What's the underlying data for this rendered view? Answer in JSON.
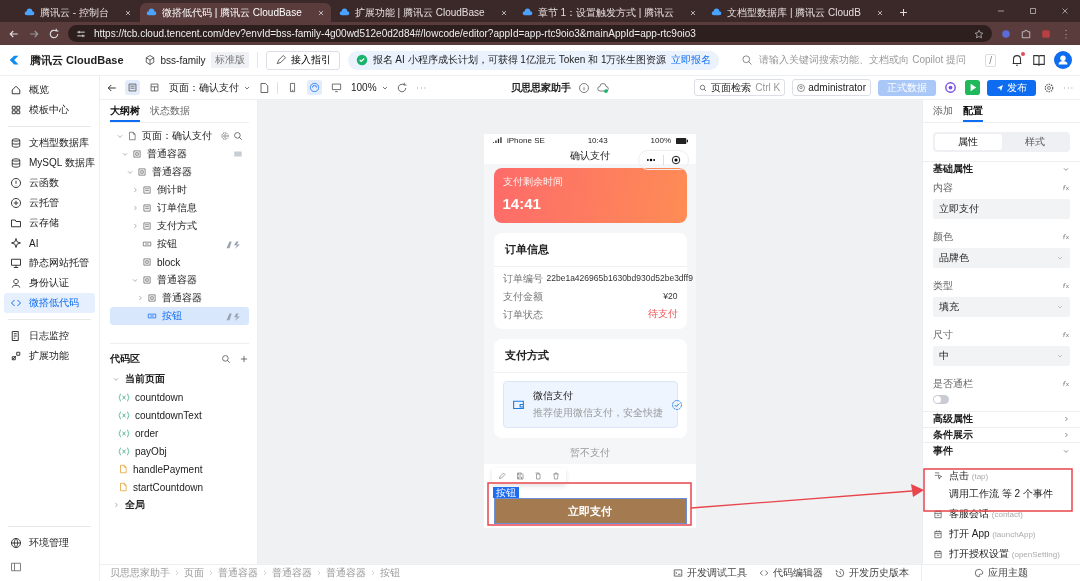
{
  "browser": {
    "tabs": [
      {
        "title": "腾讯云 - 控制台",
        "selected": false
      },
      {
        "title": "微搭低代码 | 腾讯云 CloudBase",
        "selected": true
      },
      {
        "title": "扩展功能 | 腾讯云 CloudBase",
        "selected": false
      },
      {
        "title": "章节 1：设置触发方式 | 腾讯云",
        "selected": false
      },
      {
        "title": "文档型数据库 | 腾讯云 CloudB",
        "selected": false
      }
    ],
    "url": "https://tcb.cloud.tencent.com/dev?envId=bss-family-4g00wd512e0d2d84#/lowcode/editor?appId=app-rtc9oio3&mainAppId=app-rtc9oio3"
  },
  "header": {
    "brand": "腾讯云 CloudBase",
    "env": "bss-family",
    "edition": "标准版",
    "guide": "接入指引",
    "banner": {
      "text": "报名 AI 小程序成长计划，可获得 1亿混元 Token 和 1万张生图资源",
      "link": "立即报名"
    },
    "search": {
      "placeholder": "请输入关键词搜索功能、文档或向 Copilot 提问",
      "shortcut": "/"
    },
    "unread": true
  },
  "nav": {
    "groups": [
      [
        {
          "label": "概览",
          "kind": "home",
          "selected": false
        },
        {
          "label": "模板中心",
          "kind": "grid",
          "selected": false
        }
      ],
      [
        {
          "label": "文档型数据库",
          "kind": "database",
          "selected": false
        },
        {
          "label": "MySQL 数据库",
          "kind": "database",
          "selected": false
        },
        {
          "label": "云函数",
          "kind": "function",
          "selected": false
        },
        {
          "label": "云托管",
          "kind": "container",
          "selected": false
        },
        {
          "label": "云存储",
          "kind": "storage",
          "selected": false
        },
        {
          "label": "AI",
          "kind": "ai",
          "selected": false
        },
        {
          "label": "静态网站托管",
          "kind": "web",
          "selected": false
        },
        {
          "label": "身份认证",
          "kind": "user",
          "selected": false
        },
        {
          "label": "微搭低代码",
          "kind": "lowcode",
          "selected": true
        }
      ],
      [
        {
          "label": "日志监控",
          "kind": "log",
          "selected": false
        },
        {
          "label": "扩展功能",
          "kind": "extension",
          "selected": false
        }
      ]
    ],
    "footer": [
      {
        "label": "环境管理",
        "kind": "globe",
        "selected": false
      }
    ]
  },
  "toolbar": {
    "views": [
      {
        "kind": "outline",
        "selected": true
      },
      {
        "kind": "layout",
        "selected": false
      }
    ],
    "page": "页面：确认支付",
    "devices": [
      {
        "kind": "mobile",
        "selected": false
      },
      {
        "kind": "responsive",
        "selected": true
      },
      {
        "kind": "desktop",
        "selected": false
      }
    ],
    "zoom": "100%",
    "app_name": "贝思思家助手",
    "search": {
      "placeholder": "页面检索",
      "shortcut": "Ctrl K"
    },
    "user": "administrator",
    "data_mode": "正式数据",
    "publish": "发布"
  },
  "outline": {
    "tabs": [
      {
        "label": "大纲树",
        "selected": true
      },
      {
        "label": "状态数据",
        "selected": false
      }
    ],
    "tree": [
      {
        "label": "页面：确认支付",
        "kind": "page",
        "expanded": true,
        "selected": false,
        "bound": false,
        "events": false,
        "children": [
          {
            "label": "普通容器",
            "kind": "container",
            "expanded": true,
            "selected": false,
            "bound": true,
            "events": false,
            "children": [
              {
                "label": "普通容器",
                "kind": "container",
                "expanded": true,
                "selected": false,
                "bound": false,
                "events": false,
                "children": [
                  {
                    "label": "倒计时",
                    "kind": "block",
                    "expanded": false,
                    "selected": false,
                    "bound": false,
                    "events": false
                  },
                  {
                    "label": "订单信息",
                    "kind": "block",
                    "expanded": false,
                    "selected": false,
                    "bound": false,
                    "events": false
                  },
                  {
                    "label": "支付方式",
                    "kind": "block",
                    "expanded": false,
                    "selected": false,
                    "bound": false,
                    "events": false
                  },
                  {
                    "label": "按钮",
                    "kind": "button",
                    "selected": false,
                    "bound": false,
                    "events": true
                  },
                  {
                    "label": "block",
                    "kind": "container",
                    "selected": false,
                    "bound": false,
                    "events": false
                  },
                  {
                    "label": "普通容器",
                    "kind": "container",
                    "expanded": true,
                    "selected": false,
                    "bound": false,
                    "events": false,
                    "children": [
                      {
                        "label": "普通容器",
                        "kind": "container",
                        "expanded": false,
                        "selected": false,
                        "bound": false,
                        "events": false
                      },
                      {
                        "label": "按钮",
                        "kind": "button",
                        "selected": true,
                        "bound": false,
                        "events": true
                      }
                    ]
                  }
                ]
              }
            ]
          }
        ]
      }
    ]
  },
  "code": {
    "title": "代码区",
    "groups": [
      {
        "label": "当前页面",
        "expanded": true,
        "items": [
          {
            "kind": "var",
            "name": "countdown"
          },
          {
            "kind": "var",
            "name": "countdownText"
          },
          {
            "kind": "var",
            "name": "order"
          },
          {
            "kind": "var",
            "name": "payObj"
          },
          {
            "kind": "func",
            "name": "handlePayment"
          },
          {
            "kind": "func",
            "name": "startCountdown"
          }
        ]
      },
      {
        "label": "全局",
        "expanded": false
      }
    ]
  },
  "phone": {
    "status": {
      "device": "iPhone SE",
      "time": "10:43",
      "battery": "100%"
    },
    "title": "确认支付",
    "countdown": {
      "label": "支付剩余时间",
      "value": "14:41"
    },
    "order": {
      "title": "订单信息",
      "rows": [
        {
          "label": "订单编号",
          "value": "22be1a426965b1630bd930d52be3dff9",
          "kind": "plain"
        },
        {
          "label": "支付金额",
          "value": "¥20",
          "kind": "plain"
        },
        {
          "label": "订单状态",
          "value": "待支付",
          "kind": "alert"
        }
      ]
    },
    "payment": {
      "title": "支付方式",
      "options": [
        {
          "name": "微信支付",
          "note": "推荐使用微信支付，安全快捷",
          "selected": true
        }
      ]
    },
    "skip": "暂不支付",
    "selection_tag": "按钮",
    "button": "立即支付"
  },
  "properties": {
    "tabs": [
      {
        "label": "添加",
        "selected": false
      },
      {
        "label": "配置",
        "selected": true
      }
    ],
    "modes": [
      {
        "label": "属性",
        "selected": true
      },
      {
        "label": "样式",
        "selected": false
      }
    ],
    "sections": [
      {
        "title": "基础属性",
        "expanded": true,
        "fields": [
          {
            "label": "内容",
            "kind": "input",
            "value": "立即支付"
          },
          {
            "label": "颜色",
            "kind": "select",
            "value": "品牌色"
          },
          {
            "label": "类型",
            "kind": "select",
            "value": "填充"
          },
          {
            "label": "尺寸",
            "kind": "select",
            "value": "中"
          },
          {
            "label": "是否通栏",
            "kind": "switch",
            "on": false
          }
        ]
      },
      {
        "title": "高级属性",
        "expanded": false
      },
      {
        "title": "条件展示",
        "expanded": false
      },
      {
        "title": "事件",
        "expanded": true,
        "events": [
          {
            "name": "点击",
            "code": "(tap)",
            "configured": true,
            "summary": "调用工作流 等 2 个事件"
          },
          {
            "name": "客服会话",
            "code": "(contact)",
            "configured": false
          },
          {
            "name": "打开 App",
            "code": "(launchApp)",
            "configured": false
          },
          {
            "name": "打开授权设置",
            "code": "(openSetting)",
            "configured": false
          }
        ]
      }
    ]
  },
  "statusbar": {
    "breadcrumb": [
      "贝思思家助手",
      "页面",
      "普通容器",
      "普通容器",
      "普通容器",
      "按钮"
    ],
    "tools": [
      {
        "label": "开发调试工具",
        "kind": "debug"
      },
      {
        "label": "代码编辑器",
        "kind": "code"
      },
      {
        "label": "开发历史版本",
        "kind": "history"
      }
    ],
    "theme": "应用主题"
  }
}
